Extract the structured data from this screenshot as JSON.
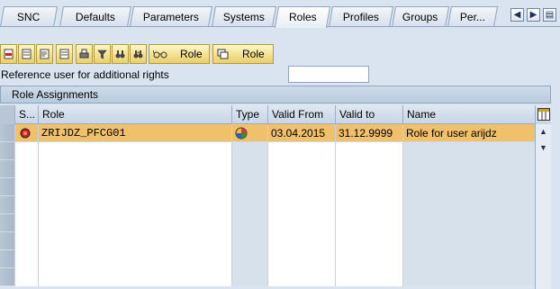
{
  "tabs": [
    "SNC",
    "Defaults",
    "Parameters",
    "Systems",
    "Roles",
    "Profiles",
    "Groups",
    "Per..."
  ],
  "active_tab": "Roles",
  "tab_nav": {
    "left": "◀",
    "right": "▶",
    "menu": "▤"
  },
  "toolbar": {
    "role_button_1": "Role",
    "role_button_2": "Role"
  },
  "reference": {
    "label": "Reference user for additional rights",
    "value": ""
  },
  "table": {
    "title": "Role Assignments",
    "columns": [
      "S...",
      "Role",
      "Type",
      "Valid From",
      "Valid to",
      "Name"
    ],
    "rows": [
      {
        "status": "error",
        "role": "ZRIJDZ_PFCG01",
        "type": "composite",
        "valid_from": "03.04.2015",
        "valid_to": "31.12.9999",
        "name": "Role for user arijdz"
      }
    ]
  },
  "colors": {
    "highlight": "#f1c06a",
    "background": "#d9e4f0",
    "toolbar_button": "#f3dd8a"
  }
}
